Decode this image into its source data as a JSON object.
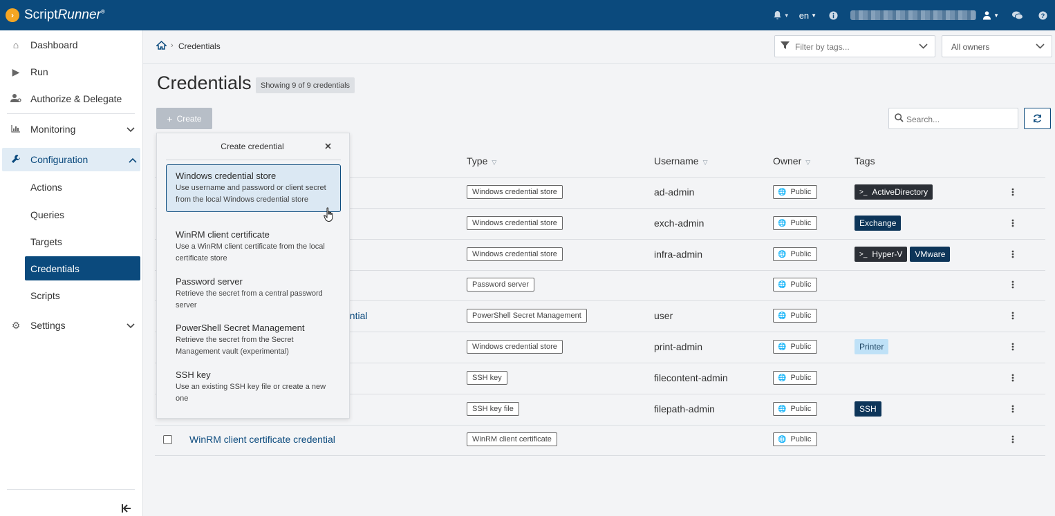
{
  "app": {
    "brand_prefix": "Script",
    "brand_suffix": "Runner",
    "brand_mark": "®",
    "language": "en"
  },
  "sidebar": {
    "items": [
      {
        "label": "Dashboard",
        "icon": "home-icon"
      },
      {
        "label": "Run",
        "icon": "play-icon"
      },
      {
        "label": "Authorize & Delegate",
        "icon": "user-key-icon"
      },
      {
        "label": "Monitoring",
        "icon": "chart-icon"
      },
      {
        "label": "Configuration",
        "icon": "wrench-icon"
      },
      {
        "label": "Settings",
        "icon": "gear-icon"
      }
    ],
    "sub_items": [
      "Actions",
      "Queries",
      "Targets",
      "Credentials",
      "Scripts"
    ],
    "active_sub": "Credentials"
  },
  "breadcrumb": {
    "current": "Credentials"
  },
  "filters": {
    "tags_placeholder": "Filter by tags...",
    "owners_value": "All owners"
  },
  "page": {
    "title": "Credentials",
    "count_text": "Showing 9 of 9 credentials",
    "create_label": "Create",
    "search_placeholder": "Search..."
  },
  "table": {
    "headers": [
      "Type",
      "Username",
      "Owner",
      "Tags"
    ],
    "rows": [
      {
        "name": "",
        "type": "Windows credential store",
        "username": "ad-admin",
        "owner": "Public",
        "tags": [
          {
            "label": "ActiveDirectory",
            "style": "dark",
            "ps": true
          }
        ]
      },
      {
        "name": "",
        "type": "Windows credential store",
        "username": "exch-admin",
        "owner": "Public",
        "tags": [
          {
            "label": "Exchange",
            "style": "navy",
            "ps": false
          }
        ]
      },
      {
        "name": "",
        "type": "Windows credential store",
        "username": "infra-admin",
        "owner": "Public",
        "tags": [
          {
            "label": "Hyper-V",
            "style": "dark",
            "ps": true
          },
          {
            "label": "VMware",
            "style": "navy",
            "ps": false
          }
        ]
      },
      {
        "name": "",
        "type": "Password server",
        "username": "",
        "owner": "Public",
        "tags": []
      },
      {
        "name": "ential",
        "type": "PowerShell Secret Management",
        "username": "user",
        "owner": "Public",
        "tags": []
      },
      {
        "name": "",
        "type": "Windows credential store",
        "username": "print-admin",
        "owner": "Public",
        "tags": [
          {
            "label": "Printer",
            "style": "light",
            "ps": false
          }
        ]
      },
      {
        "name": "",
        "type": "SSH key",
        "username": "filecontent-admin",
        "owner": "Public",
        "tags": []
      },
      {
        "name": "",
        "type": "SSH key file",
        "username": "filepath-admin",
        "owner": "Public",
        "tags": [
          {
            "label": "SSH",
            "style": "navy",
            "ps": false
          }
        ]
      },
      {
        "name": "WinRM client certificate credential",
        "type": "WinRM client certificate",
        "username": "",
        "owner": "Public",
        "tags": []
      }
    ]
  },
  "popover": {
    "title": "Create credential",
    "items": [
      {
        "title": "Windows credential store",
        "desc": "Use username and password or client secret from the local Windows credential store"
      },
      {
        "title": "WinRM client certificate",
        "desc": "Use a WinRM client certificate from the local certificate store"
      },
      {
        "title": "Password server",
        "desc": "Retrieve the secret from a central password server"
      },
      {
        "title": "PowerShell Secret Management",
        "desc": "Retrieve the secret from the Secret Management vault (experimental)"
      },
      {
        "title": "SSH key",
        "desc": "Use an existing SSH key file or create a new one"
      }
    ]
  },
  "colors": {
    "primary": "#0b4a7d",
    "accent": "#f5a623",
    "tag_dark": "#2b2f36",
    "tag_navy": "#0d3559",
    "tag_light": "#bfe1f7"
  }
}
